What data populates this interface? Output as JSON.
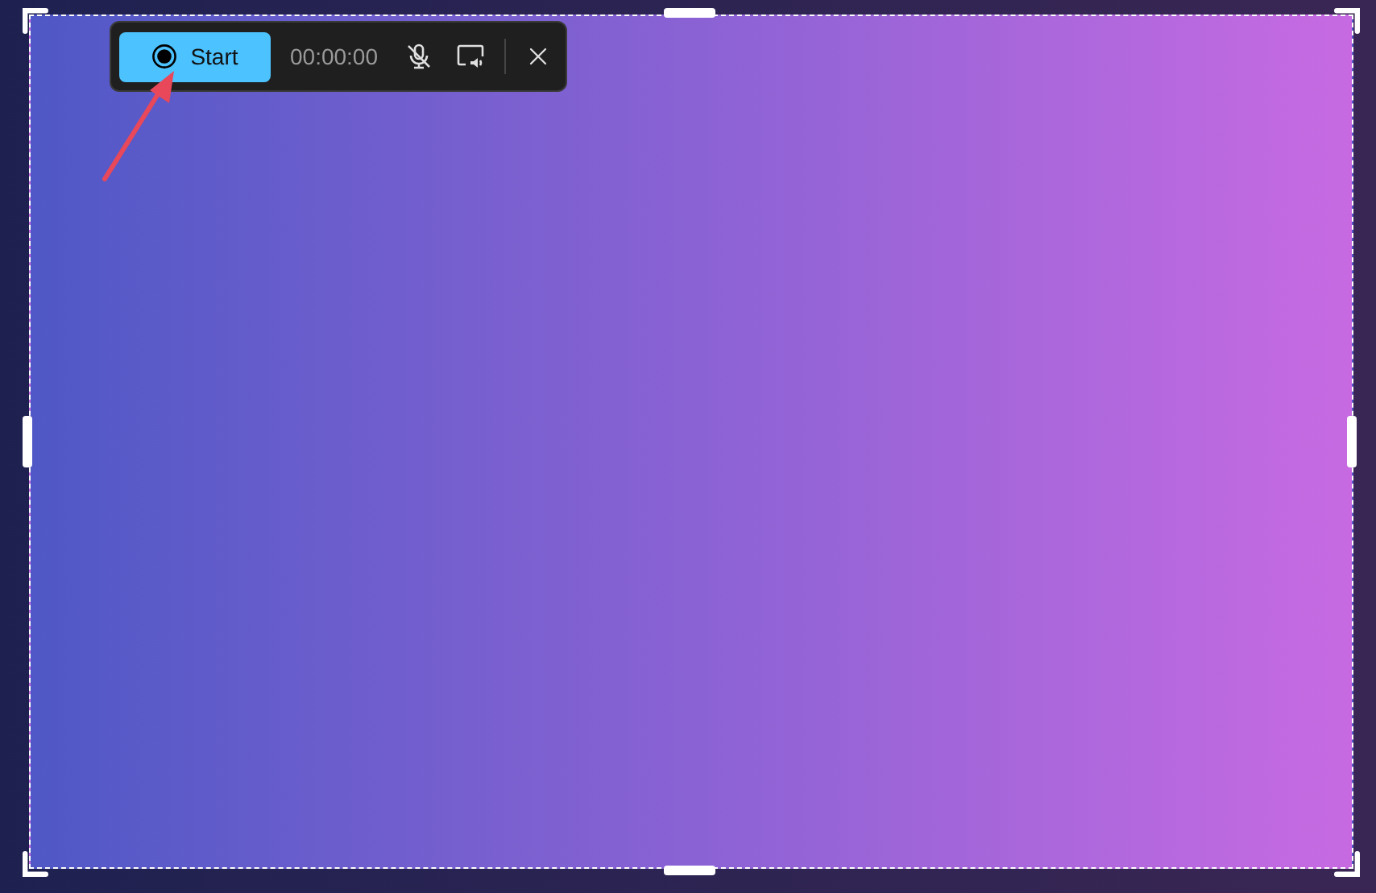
{
  "toolbar": {
    "start_button": {
      "label": "Start"
    },
    "timer": "00:00:00",
    "microphone": {
      "muted": true
    }
  }
}
